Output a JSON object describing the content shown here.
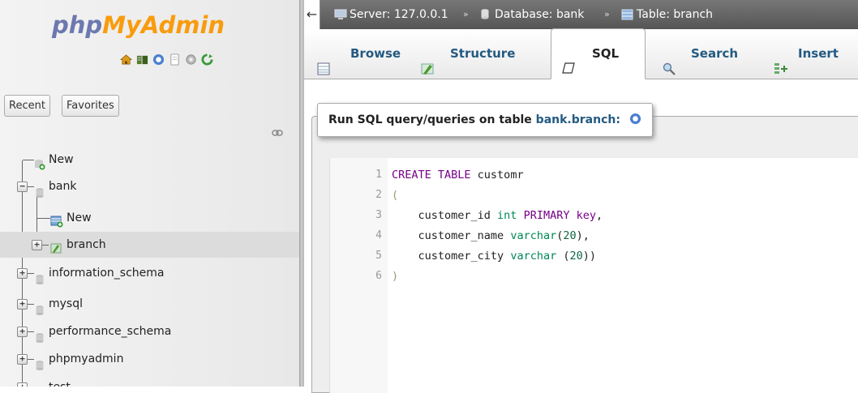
{
  "nav": {
    "logo_part1": "php",
    "logo_part2": "MyAdmin",
    "icons": [
      "home-icon",
      "database-icon",
      "help-icon",
      "documentation-icon",
      "settings-icon",
      "reload-icon"
    ],
    "recent_label": "Recent",
    "favorites_label": "Favorites",
    "tree": [
      {
        "label": "New",
        "level": 0,
        "type": "new"
      },
      {
        "label": "bank",
        "level": 0,
        "type": "db",
        "expanded": true
      },
      {
        "label": "New",
        "level": 1,
        "type": "new-table"
      },
      {
        "label": "branch",
        "level": 1,
        "type": "table",
        "selected": true
      },
      {
        "label": "information_schema",
        "level": 0,
        "type": "db"
      },
      {
        "label": "mysql",
        "level": 0,
        "type": "db"
      },
      {
        "label": "performance_schema",
        "level": 0,
        "type": "db"
      },
      {
        "label": "phpmyadmin",
        "level": 0,
        "type": "db"
      },
      {
        "label": "test",
        "level": 0,
        "type": "db"
      }
    ]
  },
  "breadcrumb": {
    "server": "Server: 127.0.0.1",
    "database": "Database: bank",
    "table": "Table: branch",
    "separator": "»"
  },
  "menu": {
    "tabs": [
      {
        "label": "Browse",
        "icon": "browse-icon"
      },
      {
        "label": "Structure",
        "icon": "structure-icon"
      },
      {
        "label": "SQL",
        "icon": "sql-icon",
        "active": true
      },
      {
        "label": "Search",
        "icon": "search-icon"
      },
      {
        "label": "Insert",
        "icon": "insert-icon"
      }
    ]
  },
  "sql_panel": {
    "legend_prefix": "Run SQL query/queries on table ",
    "legend_table": "bank.branch:",
    "line_numbers": [
      "1",
      "2",
      "3",
      "4",
      "5",
      "6"
    ]
  },
  "colors": {
    "keyword": "#770088",
    "type": "#008855",
    "link": "#235a81",
    "logo_php": "#6c78af",
    "logo_myadmin": "#f89c0e"
  }
}
